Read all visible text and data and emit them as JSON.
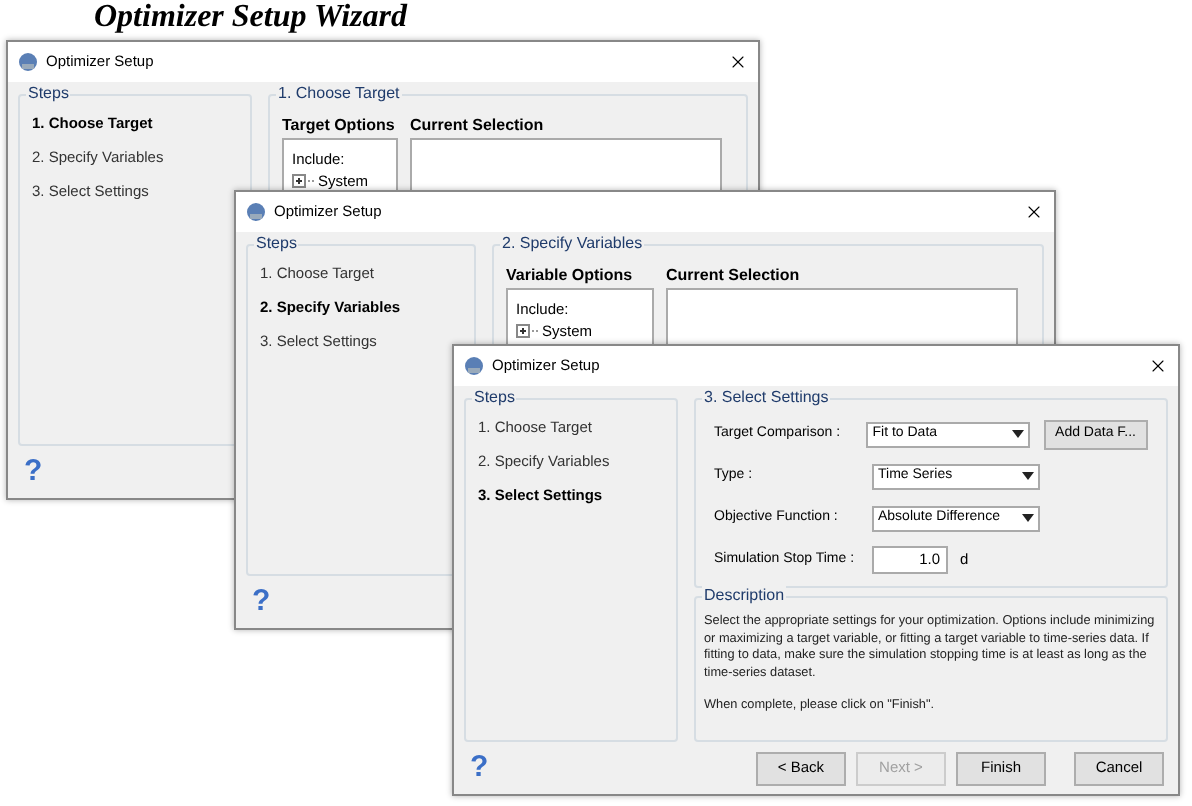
{
  "heading": "Optimizer Setup Wizard",
  "windows": [
    {
      "title": "Optimizer Setup",
      "steps_label": "Steps",
      "steps": [
        {
          "label": "1. Choose Target",
          "selected": true
        },
        {
          "label": "2. Specify Variables",
          "selected": false
        },
        {
          "label": "3. Select Settings",
          "selected": false
        }
      ],
      "kind": "options",
      "section_title": "1. Choose Target",
      "options_heading": "Target Options",
      "selection_heading": "Current Selection",
      "tree_label": "Include:",
      "tree_items": [
        "System"
      ],
      "help": "?"
    },
    {
      "title": "Optimizer Setup",
      "steps_label": "Steps",
      "steps": [
        {
          "label": "1. Choose Target",
          "selected": false
        },
        {
          "label": "2. Specify Variables",
          "selected": true
        },
        {
          "label": "3. Select Settings",
          "selected": false
        }
      ],
      "kind": "options",
      "section_title": "2. Specify Variables",
      "options_heading": "Variable Options",
      "selection_heading": "Current Selection",
      "tree_label": "Include:",
      "tree_items": [
        "System"
      ],
      "help": "?"
    },
    {
      "title": "Optimizer Setup",
      "steps_label": "Steps",
      "steps": [
        {
          "label": "1. Choose Target",
          "selected": false
        },
        {
          "label": "2. Specify Variables",
          "selected": false
        },
        {
          "label": "3. Select Settings",
          "selected": true
        }
      ],
      "kind": "settings",
      "section_title": "3. Select Settings",
      "fields": [
        {
          "kind": "select",
          "label": "Target Comparison :",
          "value": "Fit to Data",
          "action": "Add Data F..."
        },
        {
          "kind": "select",
          "label": "Type :",
          "value": "Time Series"
        },
        {
          "kind": "select",
          "label": "Objective Function :",
          "value": "Absolute Difference"
        },
        {
          "kind": "input",
          "label": "Simulation Stop Time :",
          "value": "1.0",
          "unit": "d"
        }
      ],
      "description_title": "Description",
      "description": [
        "Select the appropriate settings for your optimization. Options include minimizing or maximizing a target variable, or fitting a target variable to time-series data. If fitting to data, make sure the simulation stopping time is at least as long as the time-series dataset.",
        "When complete, please click on \"Finish\"."
      ],
      "help": "?",
      "buttons": [
        {
          "label": "< Back",
          "disabled": false
        },
        {
          "label": "Next >",
          "disabled": true
        },
        {
          "label": "Finish",
          "disabled": false
        },
        {
          "label": "Cancel",
          "disabled": false
        }
      ]
    }
  ]
}
